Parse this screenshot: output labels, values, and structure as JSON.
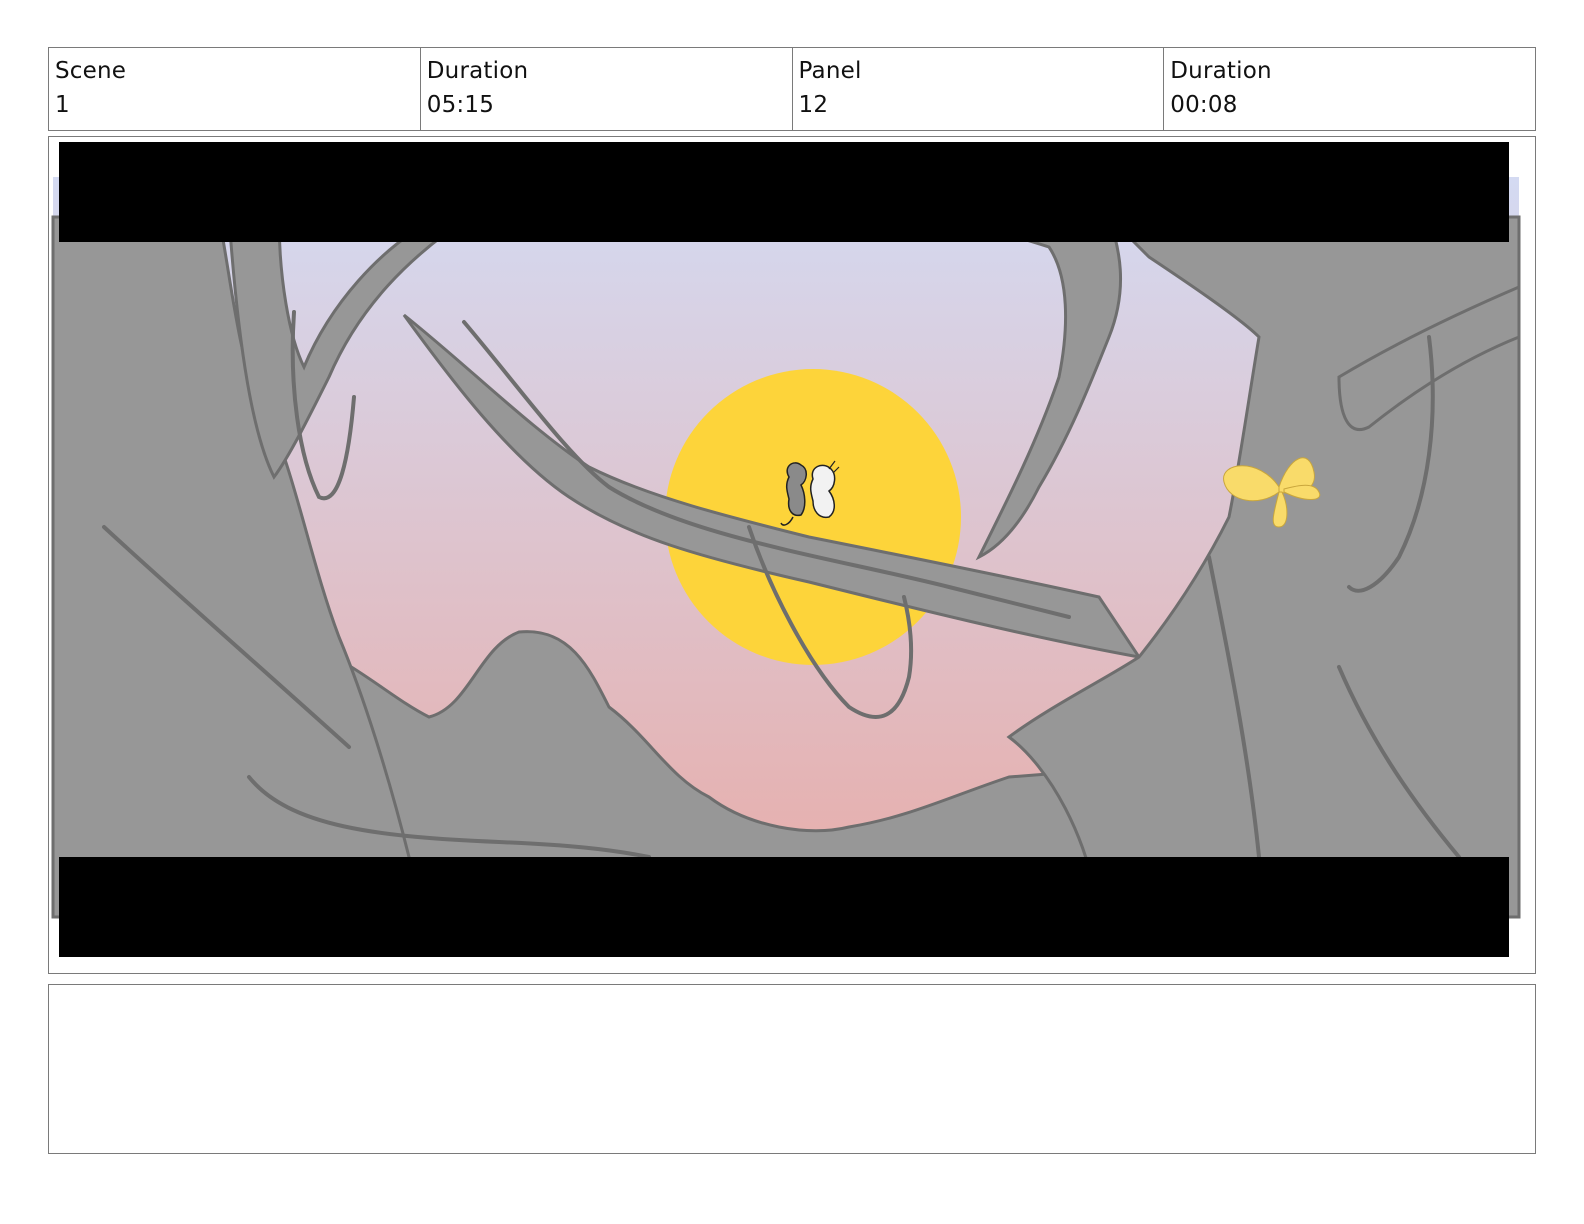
{
  "header": {
    "scene_label": "Scene",
    "scene_value": "1",
    "scene_duration_label": "Duration",
    "scene_duration_value": "05:15",
    "panel_label": "Panel",
    "panel_value": "12",
    "panel_duration_label": "Duration",
    "panel_duration_value": "00:08"
  },
  "artwork": {
    "sky_top_color": "#d4daf2",
    "sky_bottom_color": "#e8aca8",
    "sun_color": "#fdd43a",
    "tree_color": "#979797",
    "tree_line_color": "#6e6e6e",
    "butterfly_color": "#f9db6a",
    "letterbox_color": "#000000"
  },
  "notes": {
    "text": ""
  }
}
